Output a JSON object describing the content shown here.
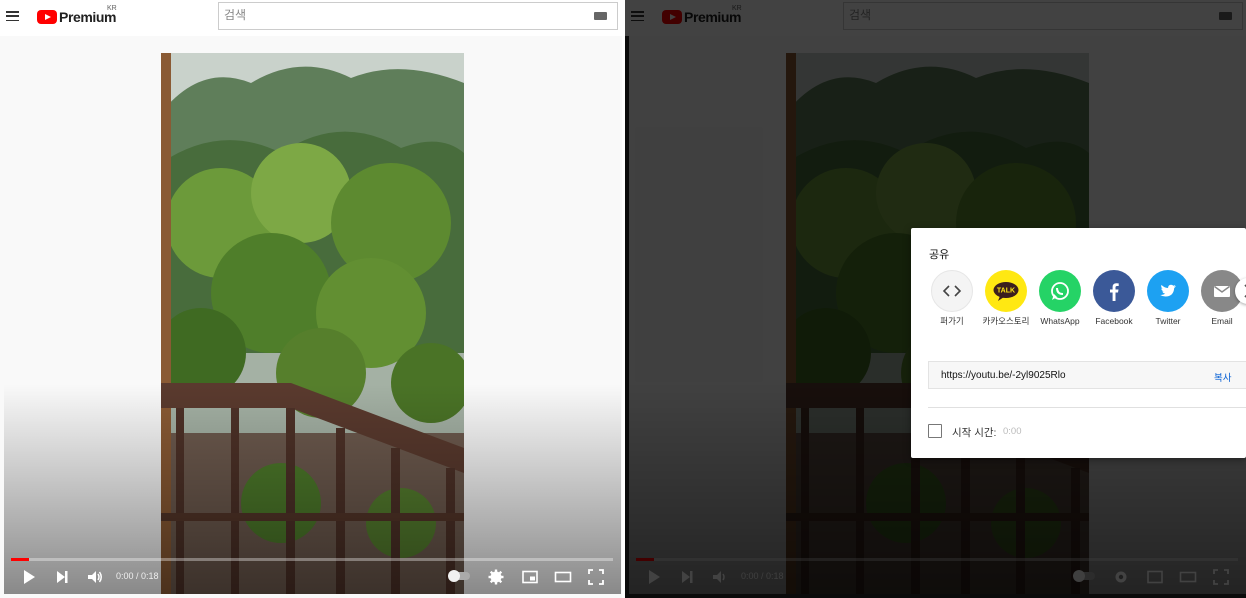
{
  "header": {
    "logo_text": "Premium",
    "country_code": "KR",
    "search_placeholder": "검색"
  },
  "player": {
    "time_display": "0:00 / 0:18",
    "progress_fraction": 0.03,
    "accent_color": "#ff0000"
  },
  "share_dialog": {
    "title": "공유",
    "targets": [
      {
        "label": "퍼가기",
        "icon": "embed-icon",
        "color": "#f4f4f4"
      },
      {
        "label": "카카오스토리",
        "icon": "kakaotalk-icon",
        "color": "#ffe812"
      },
      {
        "label": "WhatsApp",
        "icon": "whatsapp-icon",
        "color": "#25d366"
      },
      {
        "label": "Facebook",
        "icon": "facebook-icon",
        "color": "#3b5998"
      },
      {
        "label": "Twitter",
        "icon": "twitter-icon",
        "color": "#1da1f2"
      },
      {
        "label": "Email",
        "icon": "email-icon",
        "color": "#888888"
      }
    ],
    "url": "https://youtu.be/-2yl9025Rlo",
    "copy_label": "복사",
    "start_at_label": "시작 시간:",
    "start_at_value": "0:00",
    "start_at_checked": false
  }
}
